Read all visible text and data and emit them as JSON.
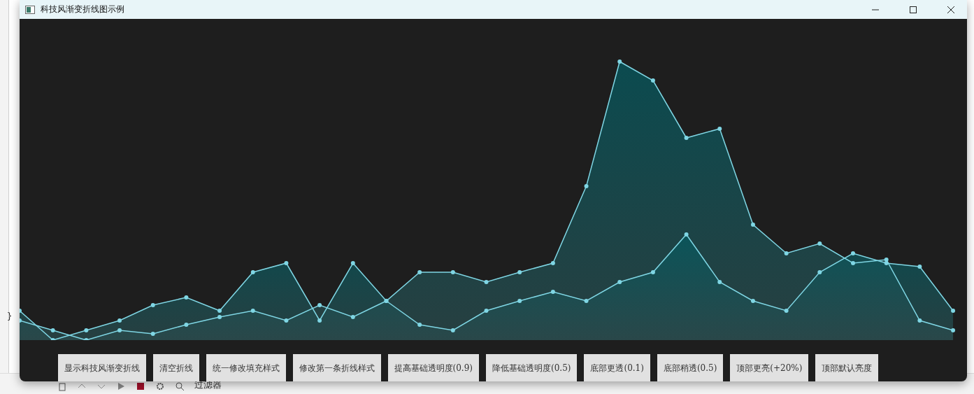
{
  "background": {
    "editor_text": "}",
    "toolbar_filter": "过滤器"
  },
  "window": {
    "title": "科技风渐变折线图示例"
  },
  "buttons": [
    "显示科技风渐变折线",
    "清空折线",
    "统一修改填充样式",
    "修改第一条折线样式",
    "提高基础透明度(0.9)",
    "降低基础透明度(0.5)",
    "底部更透(0.1)",
    "底部稍透(0.5)",
    "顶部更亮(+20%)",
    "顶部默认亮度"
  ]
}
